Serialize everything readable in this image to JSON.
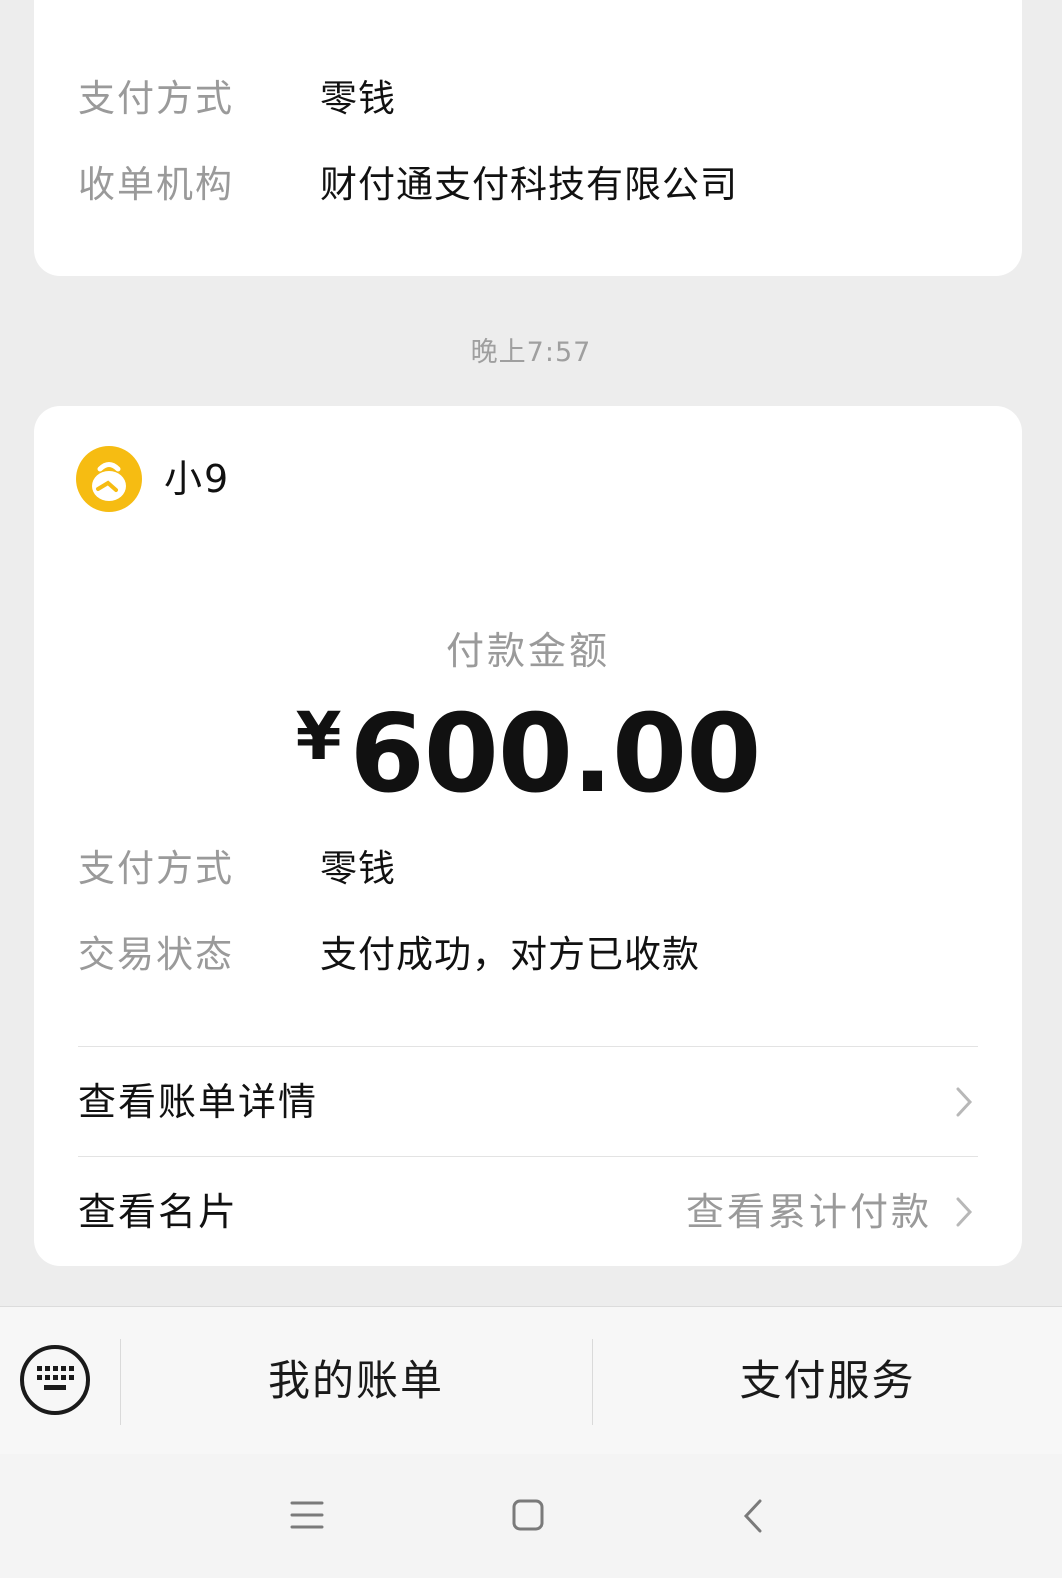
{
  "top_card": {
    "rows": [
      {
        "label": "支付方式",
        "value": "零钱"
      },
      {
        "label": "收单机构",
        "value": "财付通支付科技有限公司"
      }
    ]
  },
  "timestamp": "晚上7:57",
  "main_card": {
    "merchant_name": "小9",
    "amount_label": "付款金额",
    "currency_symbol": "¥",
    "amount": "600.00",
    "rows": [
      {
        "label": "支付方式",
        "value": "零钱"
      },
      {
        "label": "交易状态",
        "value": "支付成功，对方已收款"
      }
    ],
    "links": [
      {
        "label": "查看账单详情"
      },
      {
        "label": "查看名片",
        "extra": "查看累计付款"
      }
    ]
  },
  "bottom_menu": {
    "items": [
      "我的账单",
      "支付服务"
    ]
  },
  "icons": {
    "avatar": "merchant-avatar-icon",
    "keyboard": "keyboard-icon",
    "chevron": "chevron-right-icon",
    "nav": [
      "menu-icon",
      "home-icon",
      "back-icon"
    ]
  },
  "colors": {
    "background": "#ededed",
    "card": "#ffffff",
    "avatar": "#f6bc12",
    "secondary_text": "#9a9a9a"
  }
}
